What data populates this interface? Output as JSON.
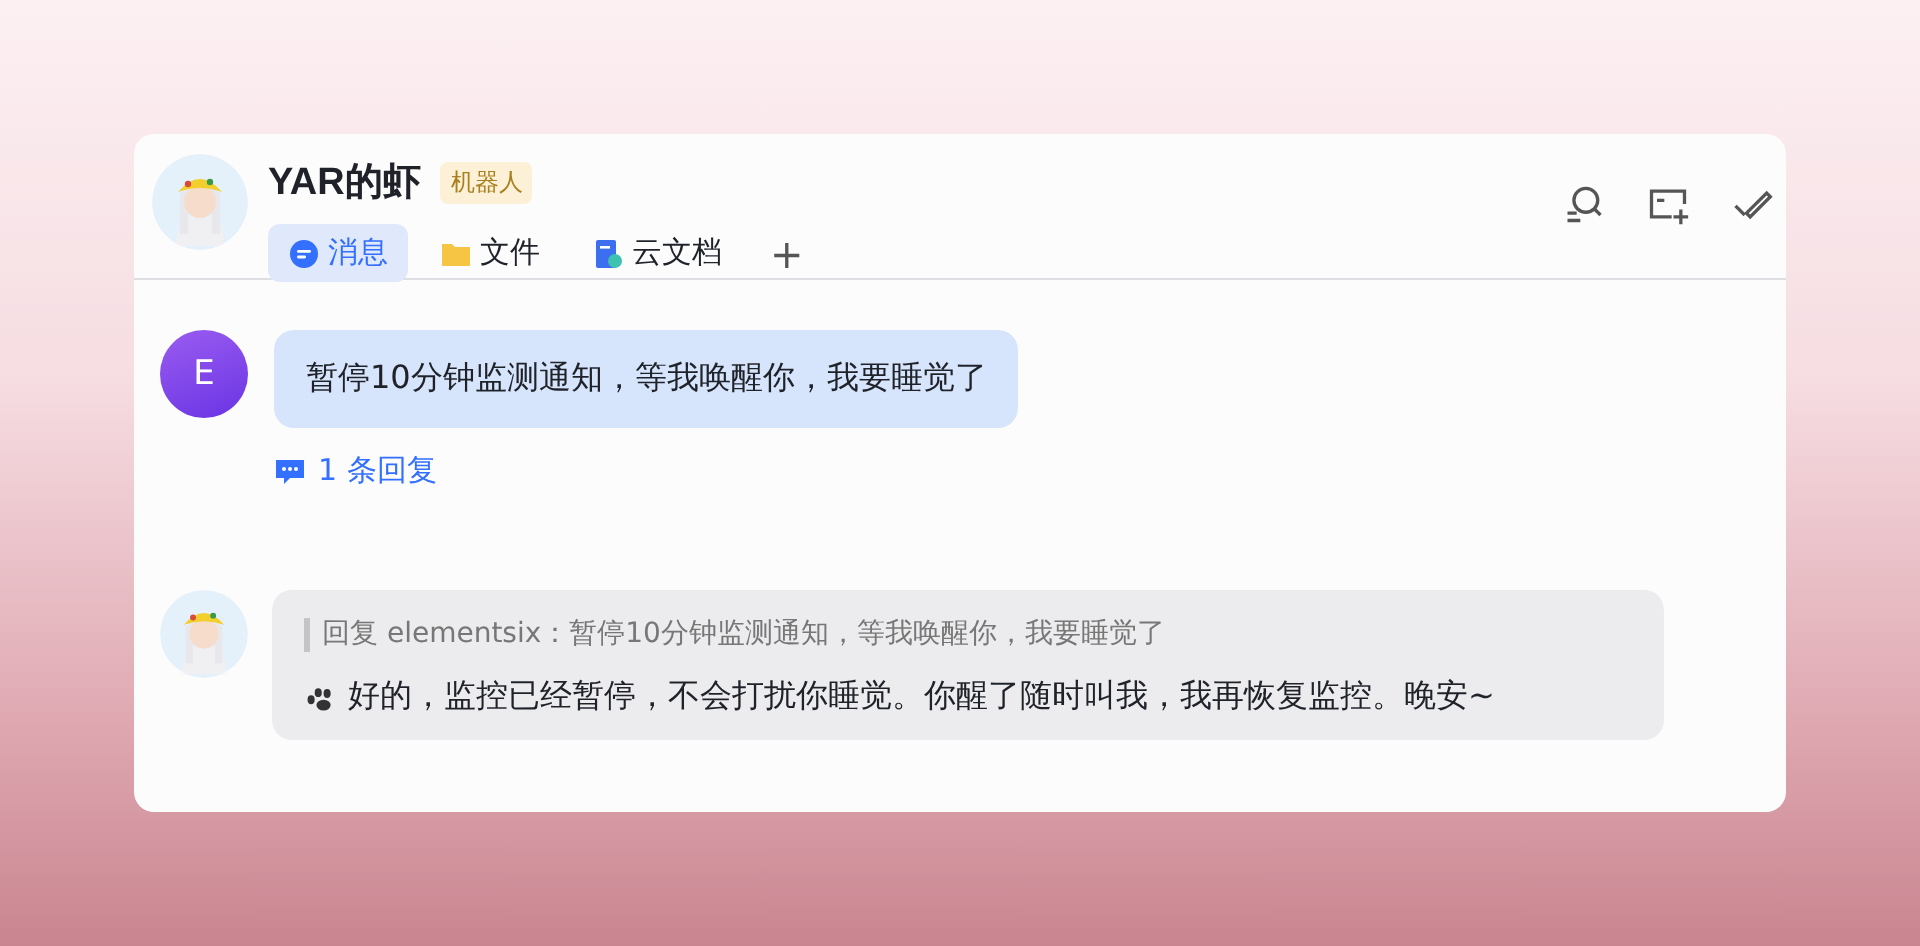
{
  "chat": {
    "title": "YAR的虾",
    "badge": "机器人",
    "tabs": [
      {
        "label": "消息",
        "kind": "chat",
        "selected": true
      },
      {
        "label": "文件",
        "kind": "folder",
        "selected": false
      },
      {
        "label": "云文档",
        "kind": "doc",
        "selected": false
      }
    ],
    "add_tab": "+"
  },
  "messages": [
    {
      "sender": {
        "kind": "letter",
        "initial": "E"
      },
      "text": "暂停10分钟监测通知，等我唤醒你，我要睡觉了",
      "kind": "own",
      "replies": "1 条回复"
    },
    {
      "sender": {
        "kind": "bot"
      },
      "kind": "bot",
      "quote": "回复 elementsix：暂停10分钟监测通知，等我唤醒你，我要睡觉了",
      "text": "好的，监控已经暂停，不会打扰你睡觉。你醒了随时叫我，我再恢复监控。晚安~"
    }
  ]
}
